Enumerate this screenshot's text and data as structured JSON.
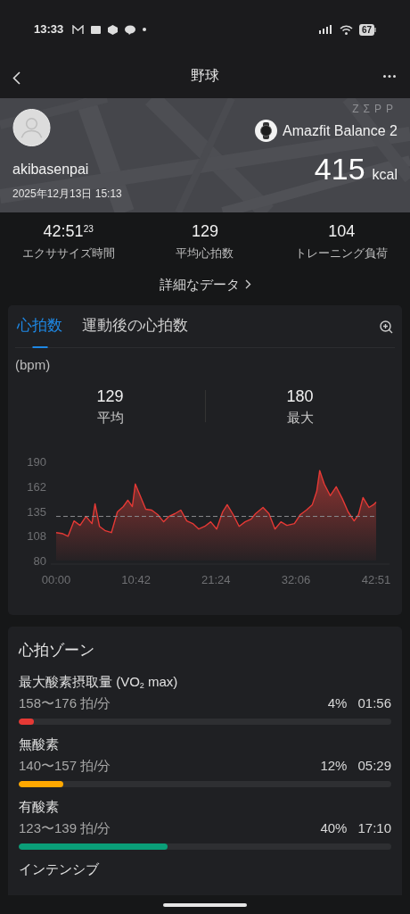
{
  "status_bar": {
    "time": "13:33",
    "battery": "67"
  },
  "header": {
    "title": "野球"
  },
  "summary": {
    "brand": "ZΣPP",
    "user": "akibasenpai",
    "date": "2025年12月13日 15:13",
    "device": "Amazfit Balance 2",
    "calories": "415",
    "calories_unit": "kcal"
  },
  "stats": [
    {
      "value": "42:51$^{23}$",
      "label": "エクササイズ時間"
    },
    {
      "value": "129",
      "label": "平均心拍数"
    },
    {
      "value": "104",
      "label": "トレーニング負荷"
    }
  ],
  "details_link": "詳細なデータ",
  "heart_card": {
    "tabs": [
      {
        "label": "心拍数",
        "selected": true
      },
      {
        "label": "運動後の心拍数",
        "selected": false
      }
    ],
    "unit": "(bpm)",
    "summary": [
      {
        "value": "129",
        "label": "平均"
      },
      {
        "value": "180",
        "label": "最大"
      }
    ],
    "chart_data": {
      "type": "area",
      "x": [
        0,
        0.8,
        1.6,
        2.4,
        3.2,
        4.0,
        4.8,
        5.2,
        5.8,
        6.6,
        7.4,
        8.2,
        9.0,
        9.6,
        10.2,
        10.6,
        11.2,
        12.0,
        12.8,
        13.6,
        14.4,
        15.1,
        15.9,
        16.7,
        17.5,
        18.3,
        19.1,
        19.9,
        20.7,
        21.5,
        22.3,
        22.9,
        23.7,
        24.5,
        25.3,
        26.1,
        26.7,
        27.7,
        28.5,
        29.3,
        30.1,
        30.9,
        31.9,
        32.7,
        33.5,
        34.3,
        34.9,
        35.3,
        35.9,
        36.7,
        37.5,
        38.3,
        39.1,
        39.9,
        40.5,
        41.1,
        41.9,
        42.5,
        42.85
      ],
      "series": [
        {
          "color": "#e53935",
          "values": [
            111,
            110,
            107,
            124,
            119,
            129,
            121,
            143,
            118,
            113,
            111,
            134,
            140,
            147,
            140,
            165,
            153,
            137,
            136,
            131,
            123,
            129,
            132,
            136,
            124,
            121,
            115,
            118,
            123,
            115,
            134,
            142,
            131,
            118,
            123,
            126,
            132,
            139,
            132,
            115,
            123,
            119,
            121,
            131,
            136,
            142,
            157,
            180,
            165,
            152,
            162,
            149,
            134,
            124,
            131,
            150,
            139,
            142,
            145
          ]
        }
      ],
      "xlim": [
        0,
        42.85
      ],
      "ylim": [
        80,
        190
      ],
      "xticks": [
        {
          "value": 0,
          "label": "00:00"
        },
        {
          "value": 10.7,
          "label": "10:42"
        },
        {
          "value": 21.4,
          "label": "21:24"
        },
        {
          "value": 32.1,
          "label": "32:06"
        },
        {
          "value": 42.85,
          "label": "42:51"
        }
      ],
      "yticks": [
        80,
        108,
        135,
        162,
        190
      ],
      "ref_lines": [
        {
          "axis": "y",
          "value": 129
        }
      ]
    }
  },
  "zones": {
    "title": "心拍ゾーン",
    "items": [
      {
        "name": "最大酸素摂取量 (VO$_{2}$ max)",
        "range": "158〜176 拍/分",
        "percent": "4%",
        "time": "01:56",
        "level": 0.04,
        "color": "#e53935"
      },
      {
        "name": "無酸素",
        "range": "140〜157 拍/分",
        "percent": "12%",
        "time": "05:29",
        "level": 0.12,
        "color": "#ffa800"
      },
      {
        "name": "有酸素",
        "range": "123〜139 拍/分",
        "percent": "40%",
        "time": "17:10",
        "level": 0.4,
        "color": "#0a9e78"
      },
      {
        "name": "インテンシブ"
      }
    ]
  }
}
